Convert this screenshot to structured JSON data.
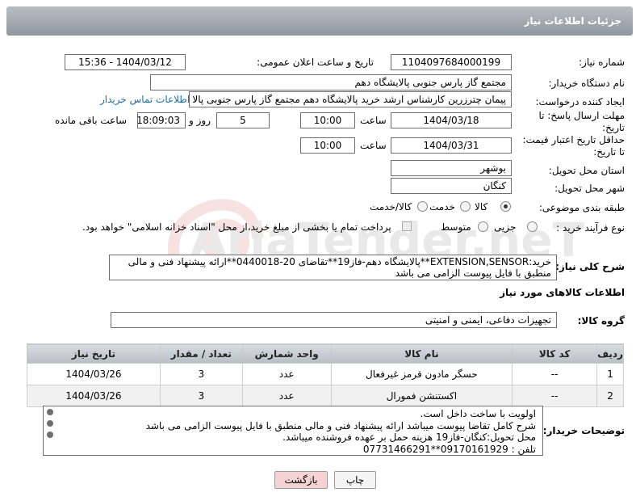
{
  "header": {
    "title": "جزئیات اطلاعات نیاز"
  },
  "labels": {
    "need_number": "شماره نیاز:",
    "announce_datetime": "تاریخ و ساعت اعلان عمومی:",
    "buyer_org": "نام دستگاه خریدار:",
    "requester": "ایجاد کننده درخواست:",
    "reply_deadline": "مهلت ارسال پاسخ: تا تاریخ:",
    "hour": "ساعت",
    "day_and": "روز و",
    "remaining": "ساعت باقی مانده",
    "price_validity": "حداقل تاریخ اعتبار قیمت: تا تاریخ:",
    "province": "استان محل تحویل:",
    "city": "شهر محل تحویل:",
    "category": "طبقه بندی موضوعی:",
    "process_type": "نوع فرآیند خرید :",
    "description": "شرح کلی نیاز:",
    "items_info": "اطلاعات کالاهای مورد نیاز",
    "goods_group": "گروه کالا:",
    "buyer_notes": "توضیحات خریدار:"
  },
  "fields": {
    "need_number": "1104097684000199",
    "announce_datetime": "1404/03/12 - 15:36",
    "buyer_org": "مجتمع گاز پارس جنوبی  پالایشگاه دهم",
    "requester": "پیمان چترزرین کارشناس ارشد خرید پالایشگاه دهم مجتمع گاز پارس جنوبی  پالا",
    "contact_link": "اطلاعات تماس خریدار",
    "reply_date": "1404/03/18",
    "reply_time": "10:00",
    "days": "5",
    "remaining_time": "18:09:03",
    "validity_date": "1404/03/31",
    "validity_time": "10:00",
    "province": "بوشهر",
    "city": "کنگان"
  },
  "category_options": [
    {
      "label": "کالا",
      "selected": true
    },
    {
      "label": "خدمت",
      "selected": false
    },
    {
      "label": "کالا/خدمت",
      "selected": false
    }
  ],
  "process_options": [
    {
      "label": "جزیی",
      "selected": false
    },
    {
      "label": "متوسط",
      "selected": false
    }
  ],
  "payment_note": "پرداخت تمام یا بخشی از مبلغ خرید،از محل \"اسناد خزانه اسلامی\" خواهد بود.",
  "description_text": {
    "line1": "خرید:EXTENSION,SENSOR**پالایشگاه دهم-فاز19**تقاضای 20-0440018**ارائه پیشنهاد فنی و مالی",
    "line2": "منطبق با فایل پیوست الزامی می باشد"
  },
  "goods_group": "تجهیزات دفاعی، ایمنی و امنیتی",
  "table": {
    "headers": [
      "ردیف",
      "کد کالا",
      "نام کالا",
      "واحد شمارش",
      "تعداد / مقدار",
      "تاریخ نیاز"
    ],
    "rows": [
      [
        "1",
        "--",
        "حسگر مادون قرمز غیرفعال",
        "عدد",
        "3",
        "1404/03/26"
      ],
      [
        "2",
        "--",
        "اکستنشن فمورال",
        "عدد",
        "3",
        "1404/03/26"
      ]
    ]
  },
  "notes": {
    "line1": "اولویت با ساخت داخل است.",
    "line2": "شرح کامل تقاضا پیوست میباشد ارائه پیشنهاد فنی و مالی منطبق با فایل پیوست الزامی می باشد",
    "line3": "محل تحویل:کنگان-فاز19 هزینه حمل بر عهده فروشنده میباشد.",
    "line4": "تلفن : 09170161929**07731466291"
  },
  "buttons": {
    "print": "چاپ",
    "back": "بازگشت"
  },
  "watermark": {
    "text": "AriaTender.neT"
  },
  "colors": {
    "header": "#9aa2a9",
    "back_button": "#f6d3d3",
    "link": "#1d6fa5"
  }
}
